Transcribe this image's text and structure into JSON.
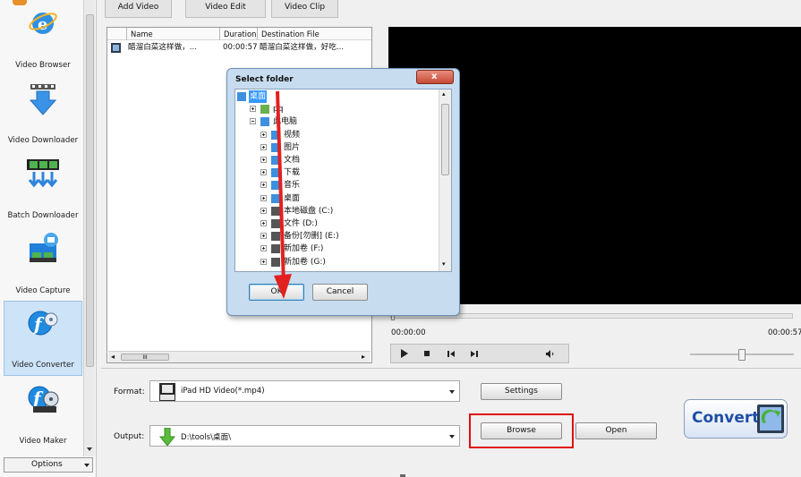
{
  "tabs": [
    "Add Video",
    "Video Edit",
    "Video Clip"
  ],
  "sidebar": {
    "items": [
      {
        "label": "Video Browser",
        "icon": "ie-globe-icon"
      },
      {
        "label": "Video Downloader",
        "icon": "download-arrow-icon"
      },
      {
        "label": "Batch Downloader",
        "icon": "film-download-icon"
      },
      {
        "label": "Video Capture",
        "icon": "camera-capture-icon"
      },
      {
        "label": "Video Converter",
        "icon": "flash-convert-icon"
      },
      {
        "label": "Video Maker",
        "icon": "film-reel-icon"
      }
    ],
    "options_label": "Options"
  },
  "file_list": {
    "columns": [
      "Name",
      "Duration",
      "Destination File"
    ],
    "rows": [
      {
        "name": "醋溜白菜这样做，...",
        "duration": "00:00:57",
        "destination": "醋溜白菜这样做，好吃..."
      }
    ],
    "hscroll_thumb": "III"
  },
  "player": {
    "time_start": "00:00:00",
    "time_end": "00:00:57"
  },
  "format": {
    "label": "Format:",
    "value": "iPad HD Video(*.mp4)",
    "settings_label": "Settings"
  },
  "output": {
    "label": "Output:",
    "value": "D:\\tools\\桌面\\",
    "browse_label": "Browse",
    "open_label": "Open"
  },
  "convert_label": "Convert",
  "dialog": {
    "title": "Select folder",
    "close_glyph": "x",
    "ok_label": "OK",
    "cancel_label": "Cancel",
    "tree": [
      {
        "label": "桌面",
        "level": 0,
        "expander": "none",
        "icon": "desktop-icon",
        "selected": true
      },
      {
        "label": "pq",
        "level": 1,
        "expander": "plus",
        "icon": "user-icon"
      },
      {
        "label": "此电脑",
        "level": 1,
        "expander": "minus",
        "icon": "computer-icon"
      },
      {
        "label": "视频",
        "level": 2,
        "expander": "plus",
        "icon": "video-folder-icon"
      },
      {
        "label": "图片",
        "level": 2,
        "expander": "plus",
        "icon": "pictures-folder-icon"
      },
      {
        "label": "文档",
        "level": 2,
        "expander": "plus",
        "icon": "documents-folder-icon"
      },
      {
        "label": "下载",
        "level": 2,
        "expander": "plus",
        "icon": "downloads-folder-icon"
      },
      {
        "label": "音乐",
        "level": 2,
        "expander": "plus",
        "icon": "music-folder-icon"
      },
      {
        "label": "桌面",
        "level": 2,
        "expander": "plus",
        "icon": "desktop-icon"
      },
      {
        "label": "本地磁盘 (C:)",
        "level": 2,
        "expander": "plus",
        "icon": "windows-drive-icon"
      },
      {
        "label": "文件 (D:)",
        "level": 2,
        "expander": "plus",
        "icon": "drive-icon"
      },
      {
        "label": "备份[勿删] (E:)",
        "level": 2,
        "expander": "plus",
        "icon": "drive-icon"
      },
      {
        "label": "新加卷 (F:)",
        "level": 2,
        "expander": "plus",
        "icon": "drive-icon"
      },
      {
        "label": "新加卷 (G:)",
        "level": 2,
        "expander": "plus",
        "icon": "drive-icon"
      }
    ]
  },
  "colors": {
    "highlight_frame": "#e01010",
    "annotation_arrow": "#e32020",
    "selection": "#3399ff",
    "preview_bg": "#000000"
  }
}
